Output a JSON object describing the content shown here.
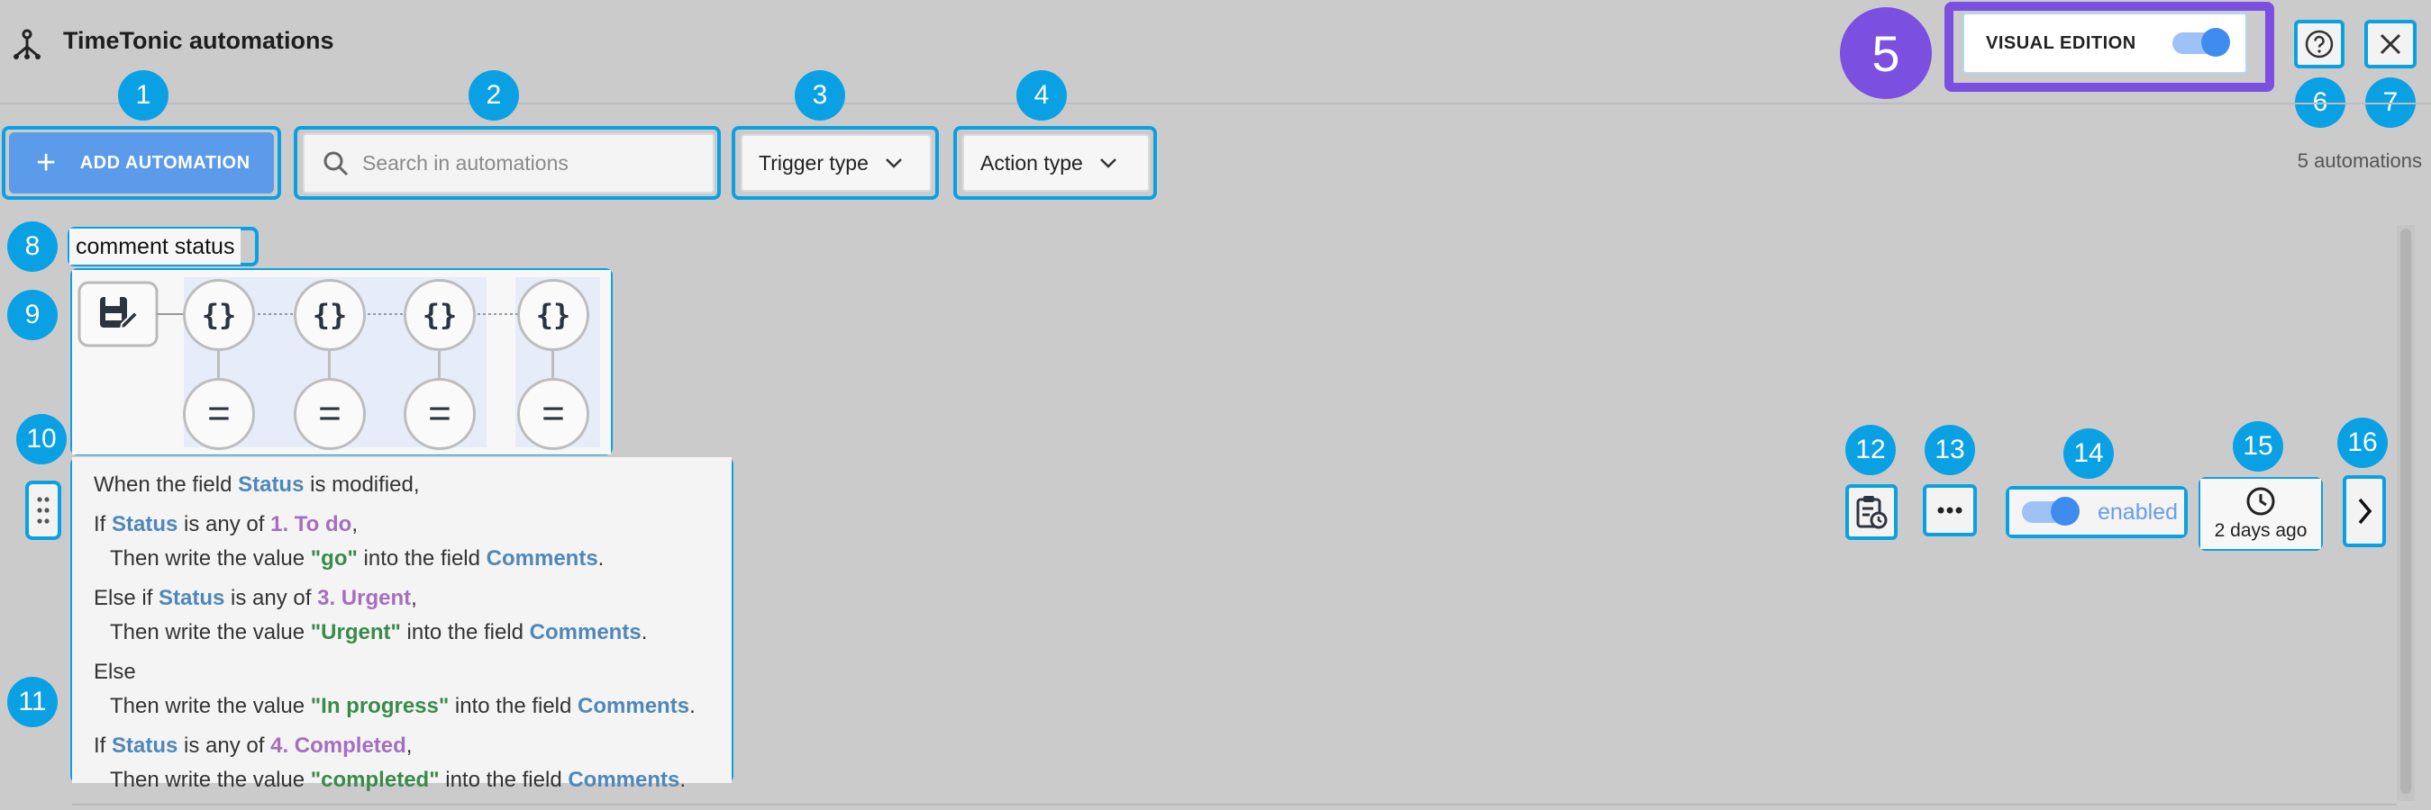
{
  "header": {
    "title": "TimeTonic automations",
    "logo_icon": "tree-nodes-icon",
    "visual_edition_label": "VISUAL EDITION",
    "visual_edition_on": true
  },
  "toolbar": {
    "add_label": "ADD AUTOMATION",
    "search_placeholder": "Search in automations",
    "trigger_label": "Trigger type",
    "action_label": "Action type",
    "count": "5 automations"
  },
  "automation": {
    "name": "comment status",
    "status": "enabled",
    "last_run": "2 days ago",
    "lines": [
      [
        {
          "t": "When the field "
        },
        {
          "t": "Status",
          "c": "blue"
        },
        {
          "t": " is modified,"
        }
      ],
      [
        {
          "t": "If "
        },
        {
          "t": "Status",
          "c": "blue"
        },
        {
          "t": " is any of "
        },
        {
          "t": "1. To do",
          "c": "purple"
        },
        {
          "t": ","
        }
      ],
      [
        {
          "t": "Then write the value "
        },
        {
          "t": "\"go\"",
          "c": "green"
        },
        {
          "t": " into the field "
        },
        {
          "t": "Comments",
          "c": "blue"
        },
        {
          "t": "."
        }
      ],
      [
        {
          "t": "Else if "
        },
        {
          "t": "Status",
          "c": "blue"
        },
        {
          "t": " is any of "
        },
        {
          "t": "3. Urgent",
          "c": "purple"
        },
        {
          "t": ","
        }
      ],
      [
        {
          "t": "Then write the value "
        },
        {
          "t": "\"Urgent\"",
          "c": "green"
        },
        {
          "t": " into the field "
        },
        {
          "t": "Comments",
          "c": "blue"
        },
        {
          "t": "."
        }
      ],
      [
        {
          "t": "Else"
        }
      ],
      [
        {
          "t": "Then write the value "
        },
        {
          "t": "\"In progress\"",
          "c": "green"
        },
        {
          "t": " into the field "
        },
        {
          "t": "Comments",
          "c": "blue"
        },
        {
          "t": "."
        }
      ],
      [
        {
          "t": "If "
        },
        {
          "t": "Status",
          "c": "blue"
        },
        {
          "t": " is any of "
        },
        {
          "t": "4. Completed",
          "c": "purple"
        },
        {
          "t": ","
        }
      ],
      [
        {
          "t": "Then write the value "
        },
        {
          "t": "\"completed\"",
          "c": "green"
        },
        {
          "t": " into the field "
        },
        {
          "t": "Comments",
          "c": "blue"
        },
        {
          "t": "."
        }
      ]
    ],
    "diagram_top_glyph": "{}",
    "diagram_bottom_glyph": "="
  },
  "callouts": [
    "1",
    "2",
    "3",
    "4",
    "5",
    "6",
    "7",
    "8",
    "9",
    "10",
    "11",
    "12",
    "13",
    "14",
    "15",
    "16"
  ],
  "colors": {
    "callout": "#0aa1e4",
    "highlight_purple": "#7b4fe0",
    "primary_button": "#5b9bea",
    "field_blue": "#4f88b8",
    "value_purple": "#a56fbf",
    "value_green": "#3a8a4a"
  }
}
